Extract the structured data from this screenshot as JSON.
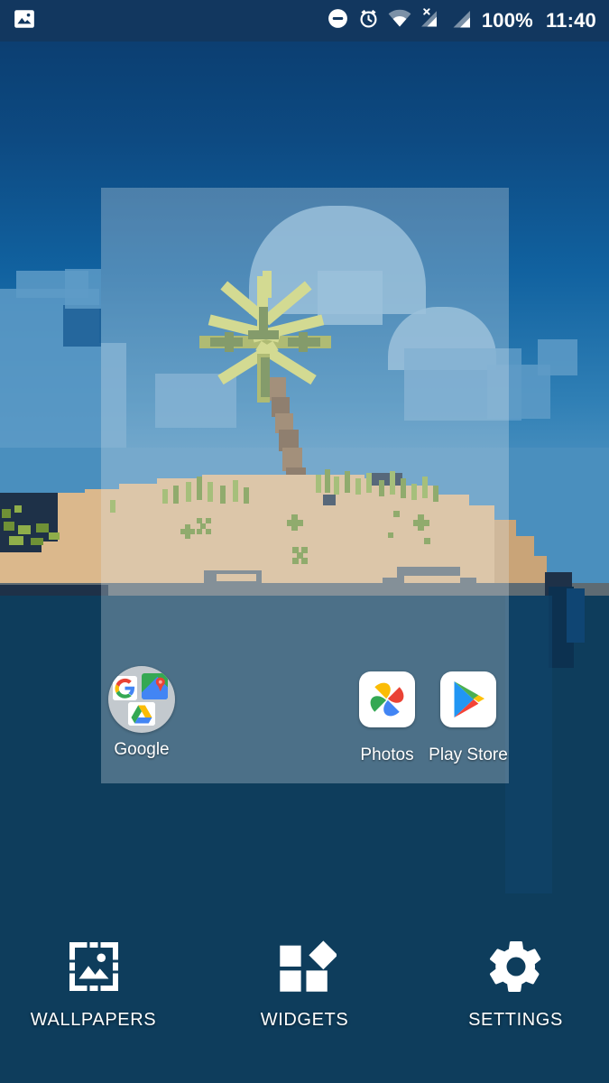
{
  "statusbar": {
    "notification_icon": "photo-icon",
    "icons": [
      "do-not-disturb-icon",
      "alarm-icon",
      "wifi-icon",
      "cellular-no-sim-icon",
      "cellular-signal-icon"
    ],
    "battery": "100%",
    "time": "11:40"
  },
  "wallpaper": {
    "name": "pixel-island-wallpaper",
    "preview_selected": true,
    "sky_color": "#0d4a82",
    "sea_upper_color": "#4a8fbe",
    "sea_lower_color": "#0e3d5c",
    "sand_color": "#dbb88c",
    "palm_frond_color": "#cfd46a",
    "trunk_color": "#8a6b4a"
  },
  "apps": [
    {
      "label": "Google",
      "icon": "google-folder-icon"
    },
    {
      "label": "Photos",
      "icon": "google-photos-icon"
    },
    {
      "label": "Play Store",
      "icon": "google-play-store-icon"
    }
  ],
  "actions": [
    {
      "label": "WALLPAPERS",
      "icon": "wallpaper-icon"
    },
    {
      "label": "WIDGETS",
      "icon": "widgets-icon"
    },
    {
      "label": "SETTINGS",
      "icon": "settings-gear-icon"
    }
  ]
}
